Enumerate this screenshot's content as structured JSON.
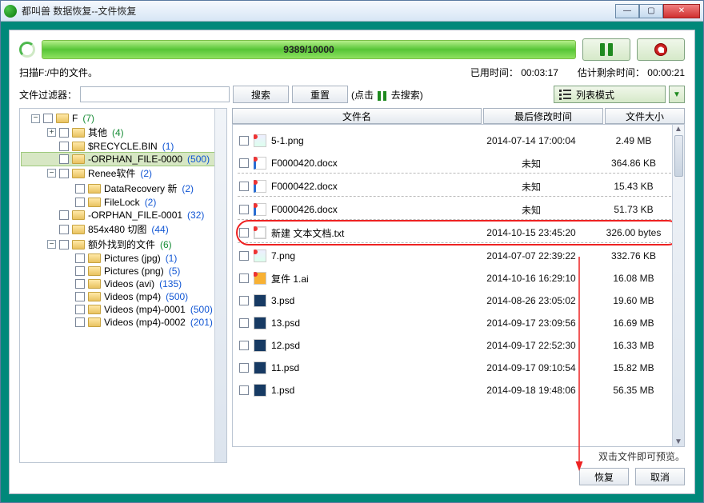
{
  "window": {
    "title": "都叫兽 数据恢复--文件恢复"
  },
  "progress": {
    "label": "9389/10000"
  },
  "scan": {
    "text": "扫描F:/中的文件。",
    "elapsed_label": "已用时间：",
    "elapsed": "00:03:17",
    "remain_label": "估计剩余时间：",
    "remain": "00:00:21"
  },
  "filter": {
    "label": "文件过滤器：",
    "value": "",
    "search_btn": "搜索",
    "reset_btn": "重置",
    "hint_pre": "(点击 ",
    "hint_post": " 去搜索)"
  },
  "viewmode": {
    "label": "列表模式"
  },
  "columns": {
    "name": "文件名",
    "mtime": "最后修改时间",
    "size": "文件大小"
  },
  "tree": [
    {
      "depth": 0,
      "exp": "▾",
      "label": "F",
      "count": "(7)",
      "cc": "g"
    },
    {
      "depth": 1,
      "exp": "▸",
      "label": "其他",
      "count": "(4)",
      "cc": "g"
    },
    {
      "depth": 1,
      "exp": "",
      "label": "$RECYCLE.BIN",
      "count": "(1)",
      "cc": "b"
    },
    {
      "depth": 1,
      "exp": "",
      "label": "-ORPHAN_FILE-0000",
      "count": "(500)",
      "cc": "b",
      "selected": true
    },
    {
      "depth": 1,
      "exp": "▾",
      "label": "Renee软件",
      "count": "(2)",
      "cc": "b"
    },
    {
      "depth": 2,
      "exp": "",
      "label": "DataRecovery 新",
      "count": "(2)",
      "cc": "b"
    },
    {
      "depth": 2,
      "exp": "",
      "label": "FileLock",
      "count": "(2)",
      "cc": "b"
    },
    {
      "depth": 1,
      "exp": "",
      "label": "-ORPHAN_FILE-0001",
      "count": "(32)",
      "cc": "b"
    },
    {
      "depth": 1,
      "exp": "",
      "label": "854x480 切图",
      "count": "(44)",
      "cc": "b"
    },
    {
      "depth": 1,
      "exp": "▾",
      "label": "额外找到的文件",
      "count": "(6)",
      "cc": "g"
    },
    {
      "depth": 2,
      "exp": "",
      "label": "Pictures (jpg)",
      "count": "(1)",
      "cc": "b"
    },
    {
      "depth": 2,
      "exp": "",
      "label": "Pictures (png)",
      "count": "(5)",
      "cc": "b"
    },
    {
      "depth": 2,
      "exp": "",
      "label": "Videos (avi)",
      "count": "(135)",
      "cc": "b"
    },
    {
      "depth": 2,
      "exp": "",
      "label": "Videos (mp4)",
      "count": "(500)",
      "cc": "b"
    },
    {
      "depth": 2,
      "exp": "",
      "label": "Videos (mp4)-0001",
      "count": "(500)",
      "cc": "b"
    },
    {
      "depth": 2,
      "exp": "",
      "label": "Videos (mp4)-0002",
      "count": "(201)",
      "cc": "b",
      "clipped": true
    }
  ],
  "files": [
    {
      "ic": "fpng pin",
      "name": "5-1.png",
      "mtime": "2014-07-14 17:00:04",
      "size": "2.49 MB"
    },
    {
      "ic": "fdoc pin",
      "name": "F0000420.docx",
      "mtime": "未知",
      "size": "364.86 KB"
    },
    {
      "ic": "fdoc pin",
      "name": "F0000422.docx",
      "mtime": "未知",
      "size": "15.43 KB",
      "dash": true
    },
    {
      "ic": "fdoc pin",
      "name": "F0000426.docx",
      "mtime": "未知",
      "size": "51.73 KB",
      "dash": true
    },
    {
      "ic": "ftxt pin",
      "name": "新建 文本文档.txt",
      "mtime": "2014-10-15 23:45:20",
      "size": "326.00 bytes",
      "highlight": true,
      "dash": true
    },
    {
      "ic": "fpng pin",
      "name": "7.png",
      "mtime": "2014-07-07 22:39:22",
      "size": "332.76 KB",
      "dash": true
    },
    {
      "ic": "fai pin",
      "name": "复件 1.ai",
      "mtime": "2014-10-16 16:29:10",
      "size": "16.08 MB"
    },
    {
      "ic": "fpsd",
      "name": "3.psd",
      "mtime": "2014-08-26 23:05:02",
      "size": "19.60 MB"
    },
    {
      "ic": "fpsd",
      "name": "13.psd",
      "mtime": "2014-09-17 23:09:56",
      "size": "16.69 MB"
    },
    {
      "ic": "fpsd",
      "name": "12.psd",
      "mtime": "2014-09-17 22:52:30",
      "size": "16.33 MB"
    },
    {
      "ic": "fpsd",
      "name": "11.psd",
      "mtime": "2014-09-17 09:10:54",
      "size": "15.82 MB"
    },
    {
      "ic": "fpsd",
      "name": "1.psd",
      "mtime": "2014-09-18 19:48:06",
      "size": "56.35 MB"
    }
  ],
  "hint": "双击文件即可预览。",
  "footer": {
    "recover": "恢复",
    "cancel": "取消"
  }
}
